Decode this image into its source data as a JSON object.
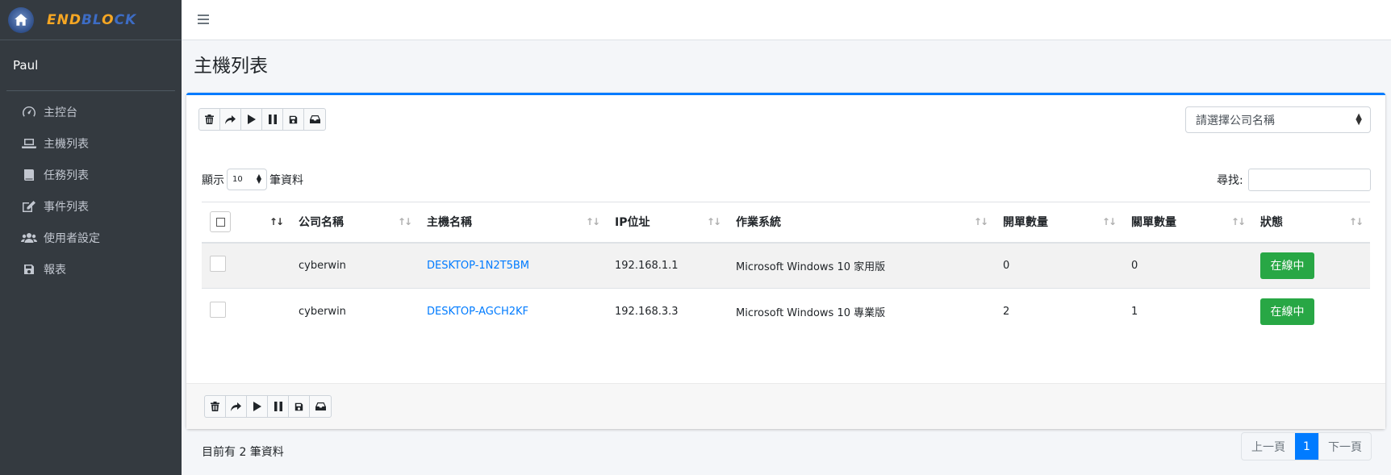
{
  "brand": {
    "part1": "END",
    "part2": "BL",
    "part3": "O",
    "part4": "CK"
  },
  "user": {
    "name": "Paul"
  },
  "sidebar": {
    "items": [
      {
        "label": "主控台",
        "icon": "dashboard-icon"
      },
      {
        "label": "主機列表",
        "icon": "laptop-icon"
      },
      {
        "label": "任務列表",
        "icon": "book-icon"
      },
      {
        "label": "事件列表",
        "icon": "edit-icon"
      },
      {
        "label": "使用者設定",
        "icon": "users-icon"
      },
      {
        "label": "報表",
        "icon": "save-icon"
      }
    ]
  },
  "page": {
    "title": "主機列表"
  },
  "toolbar": {
    "buttons": [
      "trash-icon",
      "share-icon",
      "play-icon",
      "pause-icon",
      "save-icon",
      "inbox-icon"
    ]
  },
  "company_select": {
    "placeholder": "請選擇公司名稱"
  },
  "length": {
    "prefix": "顯示",
    "value": "10",
    "suffix": "筆資料"
  },
  "search": {
    "label": "尋找:"
  },
  "table": {
    "headers": [
      "公司名稱",
      "主機名稱",
      "IP位址",
      "作業系統",
      "開單數量",
      "關單數量",
      "狀態"
    ],
    "rows": [
      {
        "company": "cyberwin",
        "host": "DESKTOP-1N2T5BM",
        "ip": "192.168.1.1",
        "os": "Microsoft Windows 10 家用版",
        "open": "0",
        "closed": "0",
        "status": "在線中"
      },
      {
        "company": "cyberwin",
        "host": "DESKTOP-AGCH2KF",
        "ip": "192.168.3.3",
        "os": "Microsoft Windows 10 專業版",
        "open": "2",
        "closed": "1",
        "status": "在線中"
      }
    ]
  },
  "info": {
    "text": "目前有 2 筆資料"
  },
  "pagination": {
    "prev": "上一頁",
    "current": "1",
    "next": "下一頁"
  },
  "colors": {
    "sidebar": "#343a40",
    "accent": "#007bff",
    "status_online": "#28a745"
  }
}
